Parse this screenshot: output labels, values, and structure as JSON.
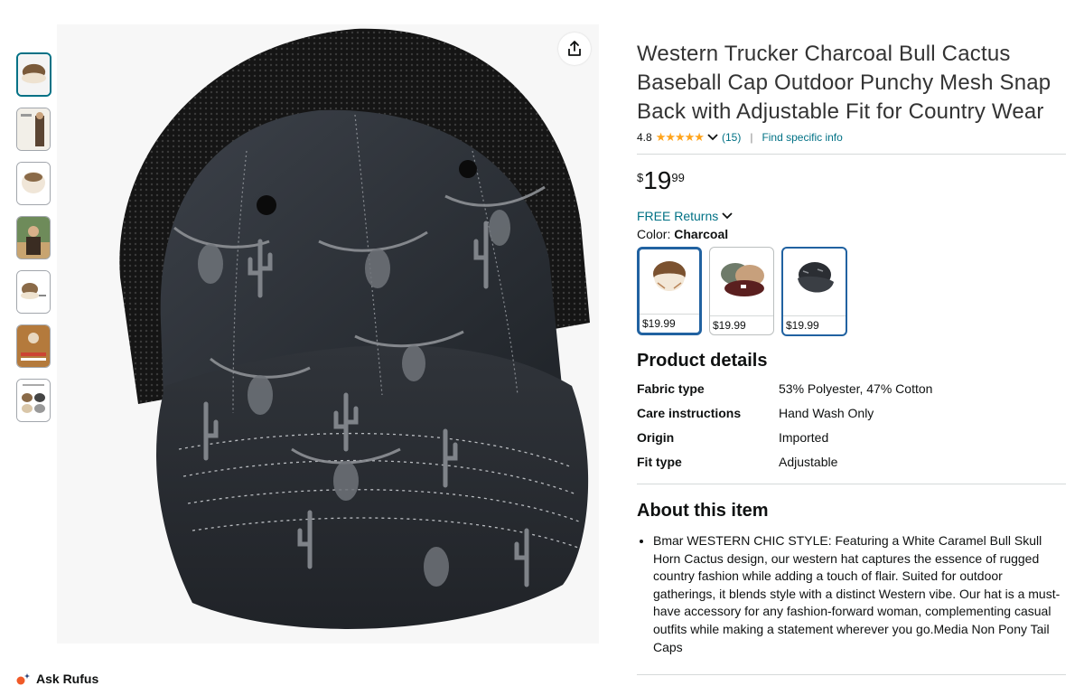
{
  "product": {
    "title": "Western Trucker Charcoal Bull Cactus Baseball Cap Outdoor Punchy Mesh Snap Back with Adjustable Fit for Country Wear",
    "rating": "4.8",
    "stars_icon": "★★★★★",
    "review_count": "(15)",
    "find_info_link": "Find specific info",
    "price_symbol": "$",
    "price_whole": "19",
    "price_fraction": "99",
    "returns_label": "FREE Returns",
    "color_label": "Color:",
    "color_value": "Charcoal"
  },
  "swatches": [
    {
      "price": "$19.99",
      "icon": "cream-cap-image"
    },
    {
      "price": "$19.99",
      "icon": "two-caps-image"
    },
    {
      "price": "$19.99",
      "icon": "charcoal-cap-image"
    }
  ],
  "details": {
    "heading": "Product details",
    "rows": [
      {
        "key": "Fabric type",
        "value": "53% Polyester, 47% Cotton"
      },
      {
        "key": "Care instructions",
        "value": "Hand Wash Only"
      },
      {
        "key": "Origin",
        "value": "Imported"
      },
      {
        "key": "Fit type",
        "value": "Adjustable"
      }
    ]
  },
  "about": {
    "heading": "About this item",
    "bullets": [
      "Bmar WESTERN CHIC STYLE: Featuring a White Caramel Bull Skull Horn Cactus design, our western hat captures the essence of rugged country fashion while adding a touch of flair. Suited for outdoor gatherings, it blends style with a distinct Western vibe. Our hat is a must-have accessory for any fashion-forward woman, complementing casual outfits while making a statement wherever you go.Media Non Pony Tail Caps"
    ]
  },
  "rufus": {
    "label": "Ask Rufus"
  },
  "colors": {
    "link": "#007185",
    "star": "#ffa41c",
    "selected": "#2162a1"
  }
}
